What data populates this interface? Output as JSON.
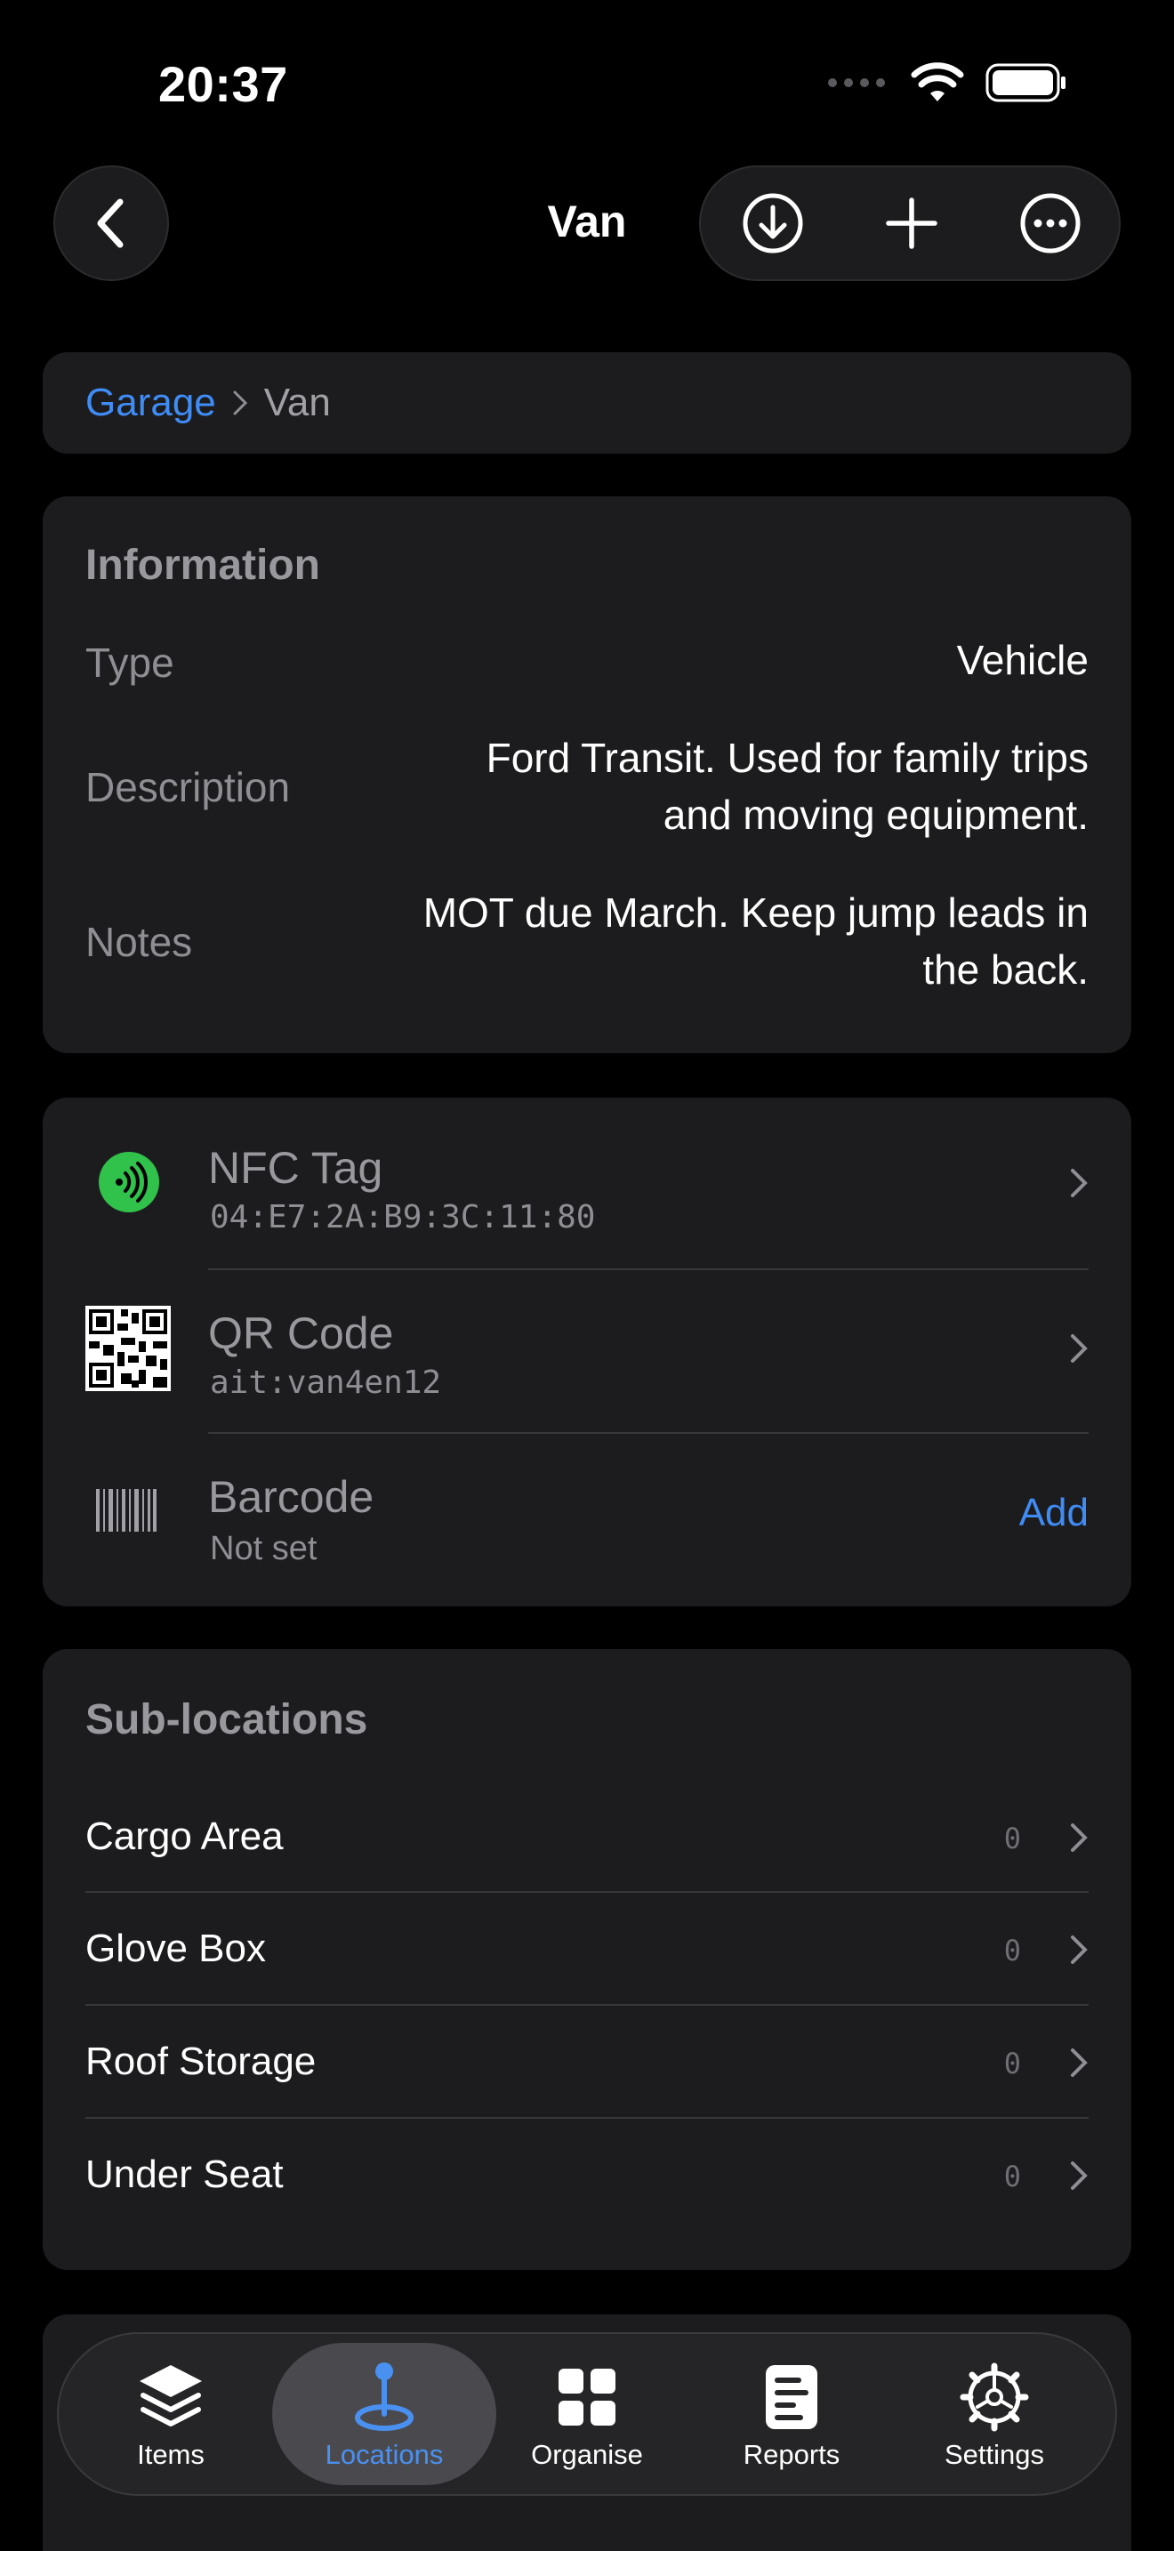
{
  "status_bar": {
    "time": "20:37"
  },
  "nav": {
    "title": "Van"
  },
  "breadcrumb": {
    "parent": "Garage",
    "current": "Van"
  },
  "information": {
    "title": "Information",
    "type_label": "Type",
    "type_value": "Vehicle",
    "description_label": "Description",
    "description_line1": "Ford Transit. Used for family trips",
    "description_line2": "and moving equipment.",
    "notes_label": "Notes",
    "notes_line1": "MOT due March. Keep jump leads in",
    "notes_line2": "the back."
  },
  "identifiers": {
    "nfc": {
      "title": "NFC Tag",
      "value": "04:E7:2A:B9:3C:11:80",
      "icon": "nfc-icon"
    },
    "qr": {
      "title": "QR Code",
      "value": "ait:van4en12",
      "icon": "qr-code-icon"
    },
    "barcode": {
      "title": "Barcode",
      "value": "Not set",
      "action": "Add",
      "icon": "barcode-icon"
    }
  },
  "sublocations": {
    "title": "Sub-locations",
    "items": [
      {
        "name": "Cargo Area",
        "count": "0"
      },
      {
        "name": "Glove Box",
        "count": "0"
      },
      {
        "name": "Roof Storage",
        "count": "0"
      },
      {
        "name": "Under Seat",
        "count": "0"
      }
    ]
  },
  "tabs": [
    {
      "label": "Items",
      "icon": "layers-icon"
    },
    {
      "label": "Locations",
      "icon": "map-pin-icon",
      "active": true
    },
    {
      "label": "Organise",
      "icon": "grid-icon"
    },
    {
      "label": "Reports",
      "icon": "report-icon"
    },
    {
      "label": "Settings",
      "icon": "gear-icon"
    }
  ],
  "colors": {
    "accent": "#3f8cf5",
    "nfc_green": "#30c24a",
    "card": "#1c1c1e"
  }
}
